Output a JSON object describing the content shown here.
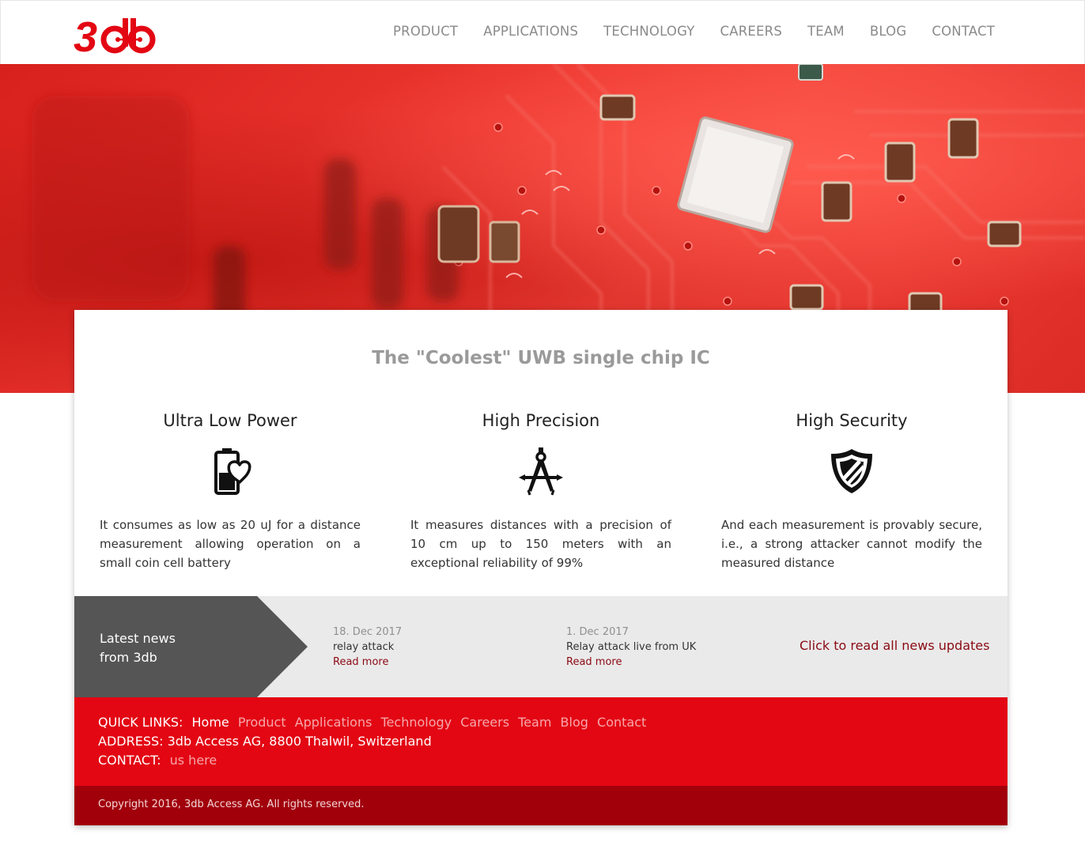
{
  "brand": {
    "logo_text": "3db",
    "accent": "#e30613",
    "dark_red": "#a1000b"
  },
  "nav": {
    "items": [
      {
        "label": "PRODUCT"
      },
      {
        "label": "APPLICATIONS"
      },
      {
        "label": "TECHNOLOGY"
      },
      {
        "label": "CAREERS"
      },
      {
        "label": "TEAM"
      },
      {
        "label": "BLOG"
      },
      {
        "label": "CONTACT"
      }
    ]
  },
  "main": {
    "title": "The \"Coolest\" UWB single chip IC",
    "features": [
      {
        "title": "Ultra Low Power",
        "icon": "battery-heart-icon",
        "text": "It consumes as low as 20 uJ for a distance measurement allowing operation on a small coin cell battery"
      },
      {
        "title": "High Precision",
        "icon": "compass-icon",
        "text": "It measures distances with a precision of 10 cm up to 150 meters with an exceptional reliability of 99%"
      },
      {
        "title": "High Security",
        "icon": "shield-icon",
        "text": "And each measurement is provably secure, i.e., a strong attacker cannot modify the measured distance"
      }
    ]
  },
  "news": {
    "label_line1": "Latest news",
    "label_line2": "from 3db",
    "items": [
      {
        "date": "18. Dec 2017",
        "title": "relay attack",
        "more": "Read more"
      },
      {
        "date": "1. Dec 2017",
        "title": "Relay attack live from UK",
        "more": "Read more"
      }
    ],
    "all_link": "Click to read all news updates"
  },
  "footer": {
    "quick_links_label": "QUICK LINKS:",
    "quick_links": [
      "Home",
      "Product",
      "Applications",
      "Technology",
      "Careers",
      "Team",
      "Blog",
      "Contact"
    ],
    "address": "ADDRESS: 3db Access AG, 8800 Thalwil, Switzerland",
    "contact_label": "CONTACT:",
    "contact_link": "us here",
    "copyright": "Copyright 2016, 3db Access AG. All rights reserved."
  }
}
